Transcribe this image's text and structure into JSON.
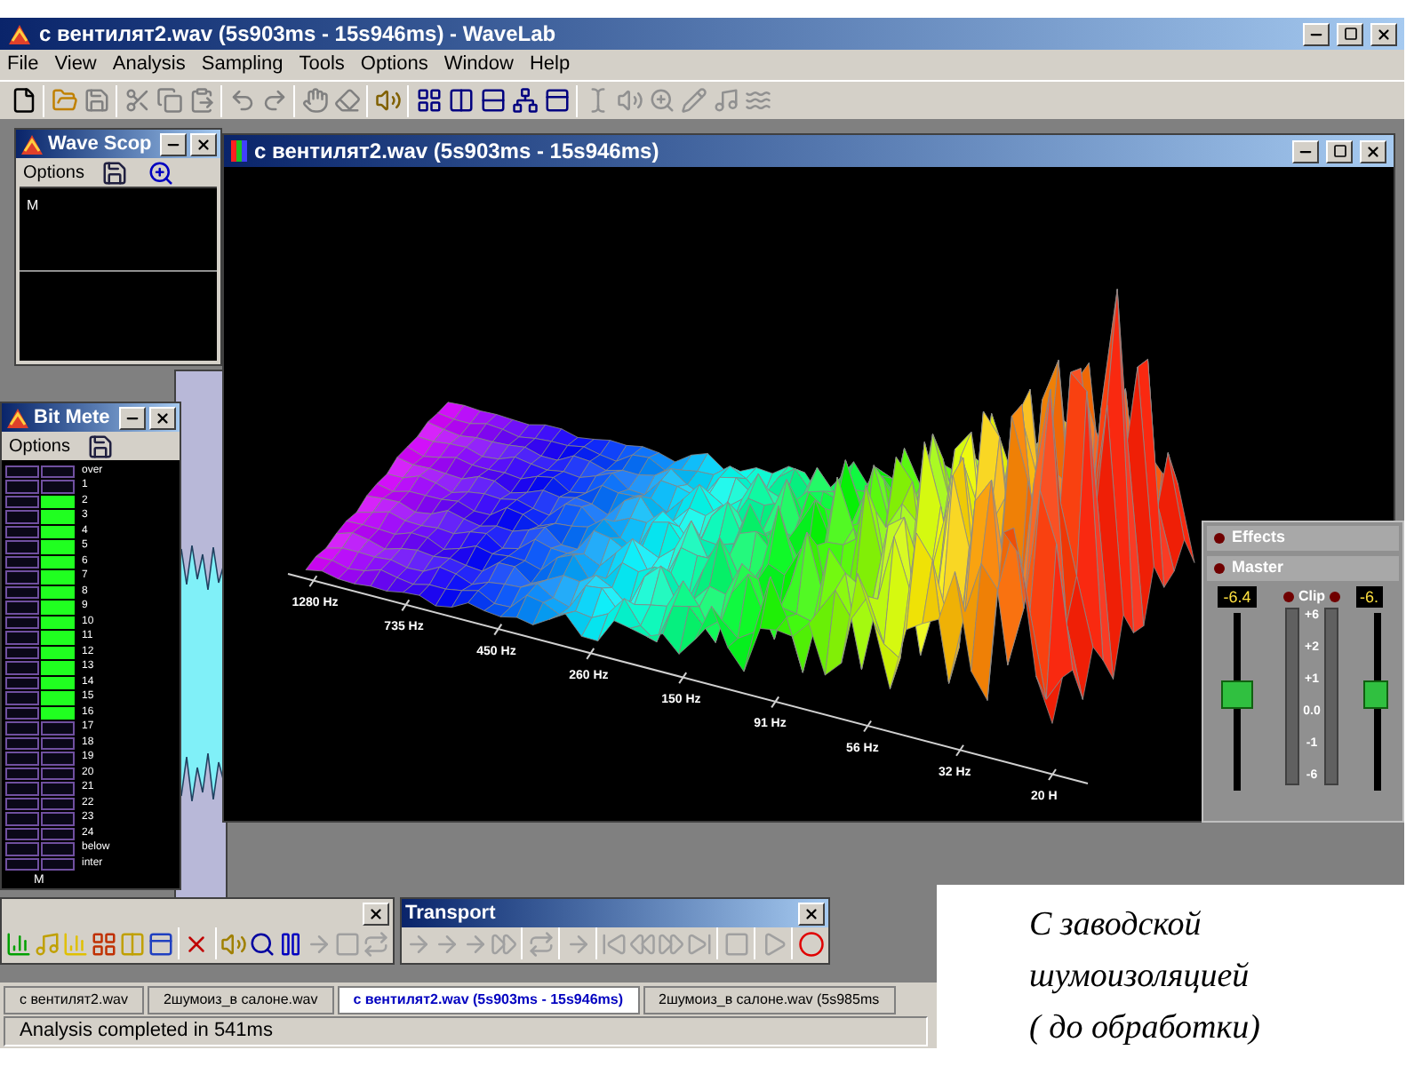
{
  "app": {
    "title": "с вентилят2.wav (5s903ms - 15s946ms) - WaveLab"
  },
  "menu": [
    "File",
    "View",
    "Analysis",
    "Sampling",
    "Tools",
    "Options",
    "Window",
    "Help"
  ],
  "wave_scope": {
    "title": "Wave Scop",
    "menu": "Options",
    "channel": "M"
  },
  "bit_meter": {
    "title": "Bit Mete",
    "menu": "Options",
    "channel": "M",
    "rows": [
      {
        "label": "over",
        "on": false
      },
      {
        "label": "1",
        "on": false
      },
      {
        "label": "2",
        "on": true
      },
      {
        "label": "3",
        "on": true
      },
      {
        "label": "4",
        "on": true
      },
      {
        "label": "5",
        "on": true
      },
      {
        "label": "6",
        "on": true
      },
      {
        "label": "7",
        "on": true
      },
      {
        "label": "8",
        "on": true
      },
      {
        "label": "9",
        "on": true
      },
      {
        "label": "10",
        "on": true
      },
      {
        "label": "11",
        "on": true
      },
      {
        "label": "12",
        "on": true
      },
      {
        "label": "13",
        "on": true
      },
      {
        "label": "14",
        "on": true
      },
      {
        "label": "15",
        "on": true
      },
      {
        "label": "16",
        "on": true
      },
      {
        "label": "17",
        "on": false
      },
      {
        "label": "18",
        "on": false
      },
      {
        "label": "19",
        "on": false
      },
      {
        "label": "20",
        "on": false
      },
      {
        "label": "21",
        "on": false
      },
      {
        "label": "22",
        "on": false
      },
      {
        "label": "23",
        "on": false
      },
      {
        "label": "24",
        "on": false
      },
      {
        "label": "below",
        "on": false
      },
      {
        "label": "inter",
        "on": false
      }
    ]
  },
  "document": {
    "title": "с вентилят2.wav (5s903ms - 15s946ms)",
    "axis_labels": [
      "1280 Hz",
      "735 Hz",
      "450 Hz",
      "260 Hz",
      "150 Hz",
      "91 Hz",
      "56 Hz",
      "32 Hz",
      "20 H"
    ]
  },
  "mixer": {
    "effects": "Effects",
    "master": "Master",
    "clip": "Clip",
    "scale": [
      "+6",
      "+2",
      "+1",
      "0.0",
      "-1",
      "-6"
    ],
    "channels": [
      {
        "readout": "-6.4",
        "level": 0.55
      },
      {
        "readout": "-6.",
        "level": 0.55
      }
    ]
  },
  "transport": {
    "title": "Transport"
  },
  "tabs": [
    {
      "label": "с вентилят2.wav",
      "selected": false
    },
    {
      "label": "2шумоиз_в салоне.wav",
      "selected": false
    },
    {
      "label": "с вентилят2.wav (5s903ms - 15s946ms)",
      "selected": true
    },
    {
      "label": "2шумоиз_в салоне.wav (5s985ms",
      "selected": false
    }
  ],
  "status_bar": "Analysis completed in 541ms",
  "caption": [
    "С заводской",
    "шумоизоляцией",
    "( до обработки)"
  ]
}
